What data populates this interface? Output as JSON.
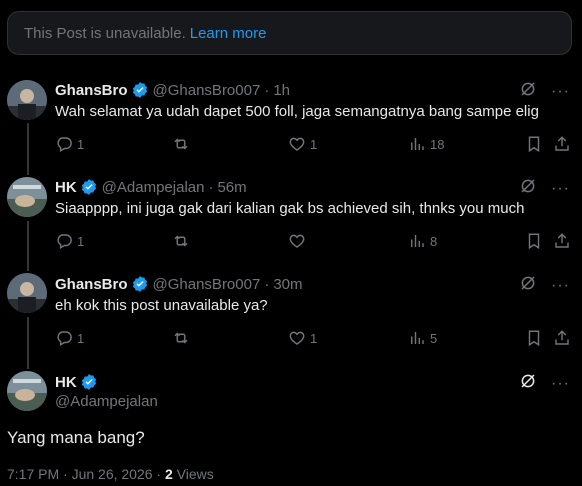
{
  "notice": {
    "text": "This Post is unavailable.",
    "link": "Learn more"
  },
  "replies": [
    {
      "name": "GhansBro",
      "handle": "@GhansBro007",
      "time": "1h",
      "text": "Wah selamat ya udah dapet 500 foll, jaga semangatnya bang sampe elig",
      "replies": "1",
      "reposts": "",
      "likes": "1",
      "views": "18"
    },
    {
      "name": "HK",
      "handle": "@Adampejalan",
      "time": "56m",
      "text": "Siaapppp,  ini juga gak dari kalian gak bs achieved sih, thnks you much",
      "replies": "1",
      "reposts": "",
      "likes": "",
      "views": "8"
    },
    {
      "name": "GhansBro",
      "handle": "@GhansBro007",
      "time": "30m",
      "text": "eh kok this post unavailable ya?",
      "replies": "1",
      "reposts": "",
      "likes": "1",
      "views": "5"
    }
  ],
  "main": {
    "name": "HK",
    "handle": "@Adampejalan",
    "text": "Yang mana bang?",
    "timestamp": "7:17 PM · Jun 26, 2026 · ",
    "views_count": "2",
    "views_label": " Views"
  },
  "colors": {
    "accent": "#1d9bf0",
    "muted": "#71767b",
    "text": "#e7e9ea",
    "background": "#000000"
  },
  "icons": [
    "checkmark-badge-icon",
    "grok-icon",
    "more-icon",
    "reply-icon",
    "repost-icon",
    "like-icon",
    "views-icon",
    "bookmark-icon",
    "share-icon"
  ]
}
